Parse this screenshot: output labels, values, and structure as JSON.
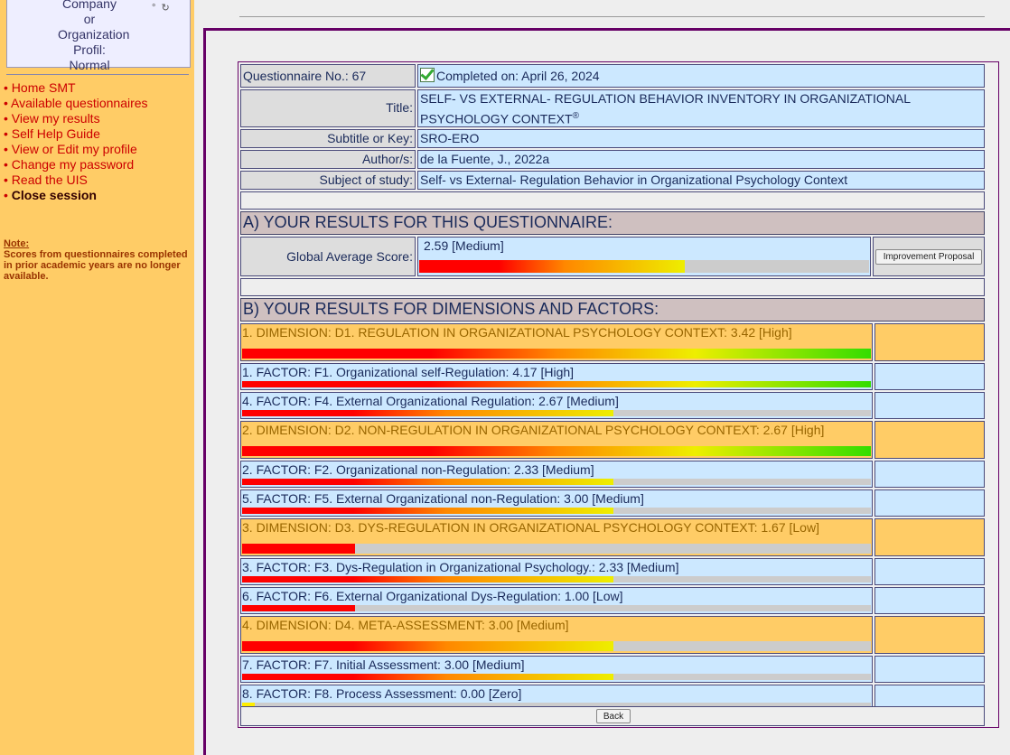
{
  "sidebar": {
    "profile_lines": [
      "Company or",
      "Organization",
      "Profil: Normal"
    ],
    "nav": [
      {
        "label": "Home SMT",
        "bold": false
      },
      {
        "label": "Available questionnaires",
        "bold": false
      },
      {
        "label": "View my results",
        "bold": false
      },
      {
        "label": "Self Help Guide",
        "bold": false
      },
      {
        "label": "View or Edit my profile",
        "bold": false
      },
      {
        "label": "Change my password",
        "bold": false
      },
      {
        "label": "Read the UIS",
        "bold": false
      },
      {
        "label": "Close session",
        "bold": true
      }
    ],
    "note_title": "Note",
    "note_text": "Scores from questionnaires completed\nin prior academic years are no longer available."
  },
  "info": {
    "questionnaire_no": "Questionnaire No.: 67",
    "completed": "Completed on: April 26, 2024",
    "title_label": "Title:",
    "title_value": "SELF- VS EXTERNAL- REGULATION BEHAVIOR INVENTORY IN ORGANIZATIONAL PSYCHOLOGY CONTEXT",
    "title_mark": "®",
    "subtitle_label": "Subtitle or Key:",
    "subtitle_value": "SRO-ERO",
    "author_label": "Author/s:",
    "author_value": "de la Fuente, J., 2022a",
    "subject_label": "Subject of study:",
    "subject_value": "Self- vs External- Regulation Behavior in Organizational Psychology Context"
  },
  "section_a": {
    "heading": "A) YOUR RESULTS FOR THIS QUESTIONNAIRE:",
    "global_label": "Global Average Score:",
    "global_value": "2.59 [Medium]",
    "global_fill": 0.59,
    "improvement_button": "Improvement Proposal"
  },
  "section_b": {
    "heading": "B) YOUR RESULTS FOR DIMENSIONS AND FACTORS:",
    "rows": [
      {
        "kind": "dim",
        "label": "1. DIMENSION: D1. REGULATION IN ORGANIZATIONAL PSYCHOLOGY CONTEXT: 3.42 [High]",
        "fill": 1.0
      },
      {
        "kind": "fac",
        "label": "1. FACTOR: F1. Organizational self-Regulation: 4.17 [High]",
        "fill": 1.0
      },
      {
        "kind": "fac",
        "label": "4. FACTOR: F4. External Organizational Regulation: 2.67 [Medium]",
        "fill": 0.59
      },
      {
        "kind": "dim",
        "label": "2. DIMENSION: D2. NON-REGULATION IN ORGANIZATIONAL PSYCHOLOGY CONTEXT: 2.67 [High]",
        "fill": 1.0
      },
      {
        "kind": "fac",
        "label": "2. FACTOR: F2. Organizational non-Regulation: 2.33 [Medium]",
        "fill": 0.59
      },
      {
        "kind": "fac",
        "label": "5. FACTOR: F5. External Organizational non-Regulation: 3.00 [Medium]",
        "fill": 0.59
      },
      {
        "kind": "dim",
        "label": "3. DIMENSION: D3. DYS-REGULATION IN ORGANIZATIONAL PSYCHOLOGY CONTEXT: 1.67 [Low]",
        "fill": 0.18
      },
      {
        "kind": "fac",
        "label": "3. FACTOR: F3. Dys-Regulation in Organizational Psychology.: 2.33 [Medium]",
        "fill": 0.59
      },
      {
        "kind": "fac",
        "label": "6. FACTOR: F6. External Organizational Dys-Regulation: 1.00 [Low]",
        "fill": 0.18
      },
      {
        "kind": "dim",
        "label": "4. DIMENSION: D4. META-ASSESSMENT: 3.00 [Medium]",
        "fill": 0.59
      },
      {
        "kind": "fac",
        "label": "7. FACTOR: F7. Initial Assessment: 3.00 [Medium]",
        "fill": 0.59
      },
      {
        "kind": "fac",
        "label": "8. FACTOR: F8. Process Assessment: 0.00 [Zero]",
        "fill": 0.02
      }
    ]
  },
  "back_button": "Back",
  "colors": {
    "sidebar": "#ffcc66",
    "dimension_row": "#ffcc66",
    "factor_row": "#cce8ff",
    "frame": "#660066"
  }
}
